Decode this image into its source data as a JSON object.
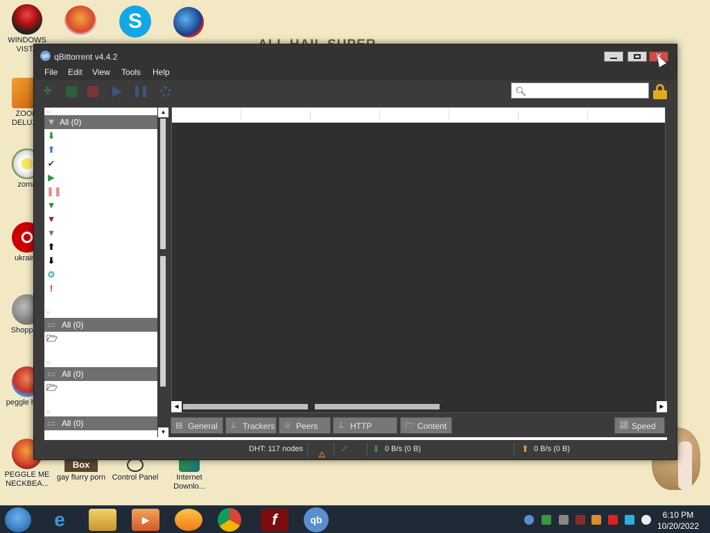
{
  "desktop": {
    "bg_text": "ALL HAIL SUPER",
    "icons": [
      {
        "label": "WINDOWS VISTA",
        "icon": "vista-orb-icon"
      },
      {
        "label": "ZOOM DELUXE",
        "icon": "zoom-icon"
      },
      {
        "label": "zoma",
        "icon": "flower-icon"
      },
      {
        "label": "ukraine",
        "icon": "radiation-icon"
      },
      {
        "label": "Shopping",
        "icon": "flash-icon"
      },
      {
        "label": "peggle hegg",
        "icon": "peggle-icon"
      },
      {
        "label": "PEGGLE ME NECKBEA...",
        "icon": "peggle-icon"
      },
      {
        "label": "gay flurry porn",
        "icon": "box-icon"
      },
      {
        "label": "Control Panel",
        "icon": "control-panel-icon"
      },
      {
        "label": "Internet Downlo...",
        "icon": "download-icon"
      }
    ],
    "box_text": "Box"
  },
  "window": {
    "title": "qBittorrent v4.4.2",
    "app_icon_text": "qb"
  },
  "menu": [
    "File",
    "Edit",
    "View",
    "Tools",
    "Help"
  ],
  "search": {
    "placeholder": "",
    "value": ""
  },
  "filters": {
    "status_all": "All (0)",
    "status_icons": [
      "downloading-icon",
      "seeding-icon",
      "completed-icon",
      "resumed-icon",
      "paused-icon",
      "active-icon",
      "inactive-icon",
      "stalled-icon",
      "stalled-uploading-icon",
      "stalled-downloading-icon",
      "checking-icon",
      "errored-icon"
    ],
    "categories_all": "All (0)",
    "tags_all": "All (0)",
    "trackers_all": "All (0)"
  },
  "tabs": [
    "General",
    "Trackers",
    "Peers",
    "HTTP Sources",
    "Content"
  ],
  "speed_tab": "Speed",
  "status": {
    "dht": "DHT: 117 nodes",
    "download": "0 B/s (0 B)",
    "upload": "0 B/s (0 B)"
  },
  "taskbar": {
    "clock_time": "6:10 PM",
    "clock_date": "10/20/2022",
    "apps": [
      "internet-explorer-icon",
      "file-explorer-icon",
      "media-player-icon",
      "uc-browser-icon",
      "chrome-icon",
      "flash-icon",
      "qbittorrent-icon"
    ],
    "qb_text": "qb",
    "flash_text": "f"
  }
}
